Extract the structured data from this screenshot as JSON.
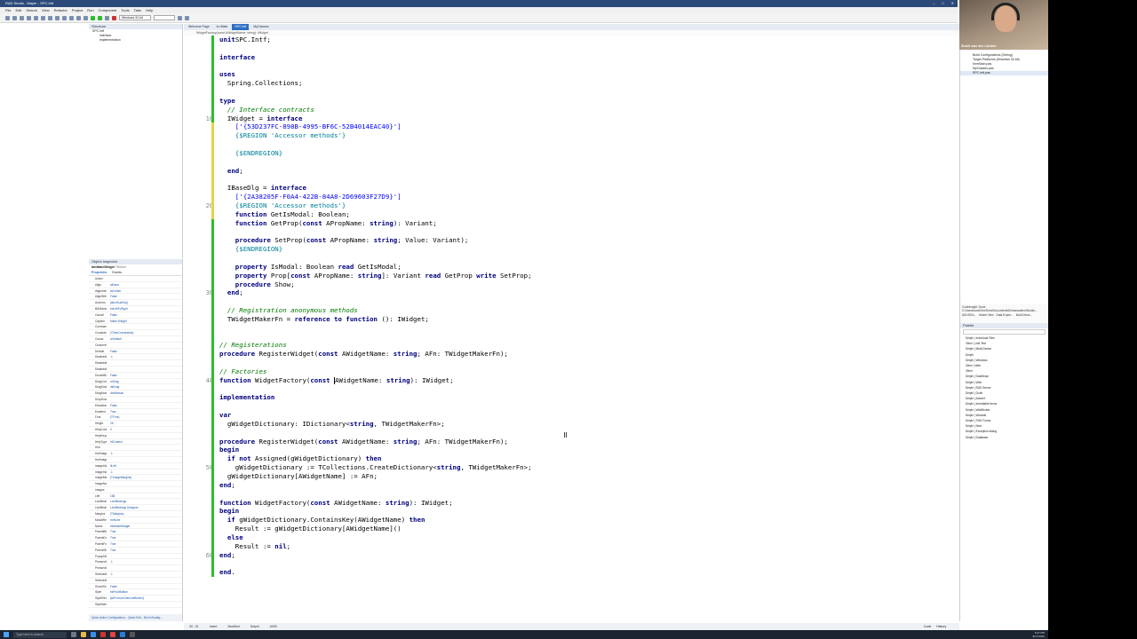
{
  "window": {
    "title": "RAD Studio - Mayer - SPC.Intf",
    "controls": [
      "–",
      "□",
      "✕"
    ]
  },
  "menu": [
    "File",
    "Edit",
    "Search",
    "View",
    "Refactor",
    "Project",
    "Run",
    "Component",
    "Tools",
    "Tabs",
    "Help"
  ],
  "toolbar": {
    "platform_combo": "Windows 32-bit"
  },
  "structure": {
    "title": "Structure",
    "items": [
      "SPC.Intf",
      "interface",
      "implementation"
    ]
  },
  "object_inspector": {
    "title": "Object Inspector",
    "component": "btnMakeWidget",
    "component_type": "TButton",
    "tabs": [
      "Properties",
      "Events"
    ],
    "rows": [
      [
        "Action",
        ""
      ],
      [
        "Align",
        "alNone"
      ],
      [
        "Alignment",
        "taCenter"
      ],
      [
        "AlignWithMargins",
        "False"
      ],
      [
        "Anchors",
        "[akLeft,akTop]"
      ],
      [
        "BiDiMode",
        "bdLeftToRight"
      ],
      [
        "Cancel",
        "False"
      ],
      [
        "Caption",
        "Make Widget"
      ],
      [
        "CommandLinkHint",
        ""
      ],
      [
        "Constraints",
        "(TSizeConstraints)"
      ],
      [
        "Cursor",
        "crDefault"
      ],
      [
        "CustomHint",
        ""
      ],
      [
        "Default",
        "False"
      ],
      [
        "DisabledImageIndex",
        "-1"
      ],
      [
        "DisabledImageName",
        ""
      ],
      [
        "DisabledImages",
        ""
      ],
      [
        "DoubleBuffered",
        "False"
      ],
      [
        "DragCursor",
        "crDrag"
      ],
      [
        "DragKind",
        "dkDrag"
      ],
      [
        "DragMode",
        "dmManual"
      ],
      [
        "DropDownMenu",
        ""
      ],
      [
        "ElevationRequired",
        "False"
      ],
      [
        "Enabled",
        "True"
      ],
      [
        "Font",
        "(TFont)"
      ],
      [
        "Height",
        "25"
      ],
      [
        "HelpContext",
        "0"
      ],
      [
        "HelpKeyword",
        ""
      ],
      [
        "HelpType",
        "htContext"
      ],
      [
        "Hint",
        ""
      ],
      [
        "HotImageIndex",
        "-1"
      ],
      [
        "HotImageName",
        ""
      ],
      [
        "ImageAlignment",
        "iiLeft"
      ],
      [
        "ImageIndex",
        "-1"
      ],
      [
        "ImageMargins",
        "(TImageMargins)"
      ],
      [
        "ImageName",
        ""
      ],
      [
        "Images",
        ""
      ],
      [
        "Left",
        "168"
      ],
      [
        "LiveBindings",
        "LiveBindings"
      ],
      [
        "LiveBindings Designer",
        "LiveBindings Designer"
      ],
      [
        "Margins",
        "(TMargins)"
      ],
      [
        "ModalResult",
        "mrNone"
      ],
      [
        "Name",
        "btnMakeWidget"
      ],
      [
        "ParentBiDiMode",
        "True"
      ],
      [
        "ParentDoubleBuffered",
        "True"
      ],
      [
        "ParentFont",
        "True"
      ],
      [
        "ParentShowHint",
        "True"
      ],
      [
        "PopupMenu",
        ""
      ],
      [
        "PressedImageIndex",
        "-1"
      ],
      [
        "PressedImageName",
        ""
      ],
      [
        "SelectedImageIndex",
        "-1"
      ],
      [
        "SelectedImageName",
        ""
      ],
      [
        "ShowHint",
        "False"
      ],
      [
        "Style",
        "bsPushButton"
      ],
      [
        "StyleElements",
        "[seFont,seClient,seBorder]"
      ],
      [
        "StyleName",
        ""
      ]
    ],
    "footer": "Quick Action Configuration...  Quick Edit...  Bind Visually...",
    "status": "All shown"
  },
  "editor": {
    "tabs": [
      "Welcome Page",
      "fo.rMain",
      "SPC.Intf",
      "MyClasses"
    ],
    "breadcrumb": [
      "WidgetFactory(const AWidgetName: string): IWidget"
    ],
    "line_numbers": [
      "10",
      "20",
      "30",
      "40",
      "50",
      "60"
    ],
    "lines": [
      [
        [
          "kw",
          "unit"
        ],
        [
          "",
          "SPC.Intf;"
        ]
      ],
      [],
      [
        [
          "kw",
          "interface"
        ]
      ],
      [],
      [
        [
          "kw",
          "uses"
        ]
      ],
      [
        [
          "",
          "  Spring.Collections;"
        ]
      ],
      [],
      [
        [
          "kw",
          "type"
        ]
      ],
      [
        [
          "cm",
          "  // Interface contracts"
        ]
      ],
      [
        [
          "",
          "  IWidget = "
        ],
        [
          "kw",
          "interface"
        ]
      ],
      [
        [
          "str",
          "    ['{53D237FC-898B-4995-BF6C-52B4014EAC40}']"
        ]
      ],
      [
        [
          "dir",
          "    {$REGION 'Accessor methods'}"
        ]
      ],
      [],
      [
        [
          "dir",
          "    {$ENDREGION}"
        ]
      ],
      [],
      [
        [
          "kw",
          "  end"
        ],
        [
          "",
          ";"
        ]
      ],
      [],
      [
        [
          "",
          "  IBaseDlg = "
        ],
        [
          "kw",
          "interface"
        ]
      ],
      [
        [
          "str",
          "    ['{2A38205F-F0A4-422B-84A8-2D69603F27D9}']"
        ]
      ],
      [
        [
          "dir",
          "    {$REGION 'Accessor methods'}"
        ]
      ],
      [
        [
          "kw",
          "    function"
        ],
        [
          "",
          " GetIsModal: Boolean;"
        ]
      ],
      [
        [
          "kw",
          "    function"
        ],
        [
          "",
          " GetProp("
        ],
        [
          "kw",
          "const"
        ],
        [
          "",
          " APropName: "
        ],
        [
          "kw",
          "string"
        ],
        [
          "",
          "): Variant;"
        ]
      ],
      [],
      [
        [
          "kw",
          "    procedure"
        ],
        [
          "",
          " SetProp("
        ],
        [
          "kw",
          "const"
        ],
        [
          "",
          " APropName: "
        ],
        [
          "kw",
          "string"
        ],
        [
          "",
          "; Value: Variant);"
        ]
      ],
      [
        [
          "dir",
          "    {$ENDREGION}"
        ]
      ],
      [],
      [
        [
          "kw",
          "    property"
        ],
        [
          "",
          " IsModal: Boolean "
        ],
        [
          "kw",
          "read"
        ],
        [
          "",
          " GetIsModal;"
        ]
      ],
      [
        [
          "kw",
          "    property"
        ],
        [
          "",
          " Prop["
        ],
        [
          "kw",
          "const"
        ],
        [
          "",
          " APropName: "
        ],
        [
          "kw",
          "string"
        ],
        [
          "",
          "]: Variant "
        ],
        [
          "kw",
          "read"
        ],
        [
          "",
          " GetProp "
        ],
        [
          "kw",
          "write"
        ],
        [
          "",
          " SetProp;"
        ]
      ],
      [
        [
          "kw",
          "    procedure"
        ],
        [
          "",
          " Show;"
        ]
      ],
      [
        [
          "kw",
          "  end"
        ],
        [
          "",
          ";"
        ]
      ],
      [],
      [
        [
          "cm",
          "  // Registration anonymous methods"
        ]
      ],
      [
        [
          "",
          "  TWidgetMakerFn = "
        ],
        [
          "kw",
          "reference to function"
        ],
        [
          "",
          " (): IWidget;"
        ]
      ],
      [],
      [],
      [
        [
          "cm",
          "// Registerations"
        ]
      ],
      [
        [
          "kw",
          "procedure"
        ],
        [
          "",
          " RegisterWidget("
        ],
        [
          "kw",
          "const"
        ],
        [
          "",
          " AWidgetName: "
        ],
        [
          "kw",
          "string"
        ],
        [
          "",
          "; AFn: TWidgetMakerFn);"
        ]
      ],
      [],
      [
        [
          "cm",
          "// Factories"
        ]
      ],
      [
        [
          "kw",
          "function"
        ],
        [
          "",
          " WidgetFactory("
        ],
        [
          "kw",
          "const"
        ],
        [
          "",
          " "
        ],
        [
          "caret",
          ""
        ],
        [
          "",
          "AWidgetName: "
        ],
        [
          "kw",
          "string"
        ],
        [
          "",
          "): IWidget;"
        ]
      ],
      [],
      [
        [
          "kw",
          "implementation"
        ]
      ],
      [],
      [
        [
          "kw",
          "var"
        ]
      ],
      [
        [
          "",
          "  gWidgetDictionary: IDictionary<"
        ],
        [
          "kw",
          "string"
        ],
        [
          "",
          ", TWidgetMakerFn>;"
        ]
      ],
      [],
      [
        [
          "kw",
          "procedure"
        ],
        [
          "",
          " RegisterWidget("
        ],
        [
          "kw",
          "const"
        ],
        [
          "",
          " AWidgetName: "
        ],
        [
          "kw",
          "string"
        ],
        [
          "",
          "; AFn: TWidgetMakerFn);"
        ]
      ],
      [
        [
          "kw",
          "begin"
        ]
      ],
      [
        [
          "kw",
          "  if not"
        ],
        [
          "",
          " Assigned(gWidgetDictionary) "
        ],
        [
          "kw",
          "then"
        ]
      ],
      [
        [
          "",
          "    gWidgetDictionary := TCollections.CreateDictionary<"
        ],
        [
          "kw",
          "string"
        ],
        [
          "",
          ", TWidgetMakerFn>;"
        ]
      ],
      [
        [
          "",
          "  gWidgetDictionary[AWidgetName] := AFn;"
        ]
      ],
      [
        [
          "kw",
          "end"
        ],
        [
          "",
          ";"
        ]
      ],
      [],
      [
        [
          "kw",
          "function"
        ],
        [
          "",
          " WidgetFactory("
        ],
        [
          "kw",
          "const"
        ],
        [
          "",
          " AWidgetName: "
        ],
        [
          "kw",
          "string"
        ],
        [
          "",
          "): IWidget;"
        ]
      ],
      [
        [
          "kw",
          "begin"
        ]
      ],
      [
        [
          "kw",
          "  if"
        ],
        [
          "",
          " gWidgetDictionary.ContainsKey(AWidgetName) "
        ],
        [
          "kw",
          "then"
        ]
      ],
      [
        [
          "",
          "    Result := gWidgetDictionary[AWidgetName]()"
        ]
      ],
      [
        [
          "kw",
          "  else"
        ]
      ],
      [
        [
          "",
          "    Result := "
        ],
        [
          "kw",
          "nil"
        ],
        [
          "",
          ";"
        ]
      ],
      [
        [
          "kw",
          "end"
        ],
        [
          "",
          ";"
        ]
      ],
      [],
      [
        [
          "kw",
          "end"
        ],
        [
          "",
          "."
        ]
      ]
    ],
    "status": [
      "40 : 31",
      "Insert",
      "Modified",
      "Delphi",
      "ANSI"
    ],
    "view_tabs": [
      "Code",
      "History"
    ]
  },
  "webcam": {
    "name": "Scott van der Linden"
  },
  "project_manager": {
    "items": [
      "Build Configurations (Debug)",
      "Target Platforms (Windows 32-bit)",
      "formMain.pas",
      "MyClasses.pas",
      "SPC.Intf.pas"
    ]
  },
  "code_insight": {
    "line1": "CodeInsight: Done",
    "line2": "C:\\Users\\scott\\OneDrive\\Documents\\Embarcadero\\Studio\\...",
    "tabs": [
      "ADUGEA...",
      "Model View",
      "Data Explor...",
      "Multi-Devic..."
    ]
  },
  "palette": {
    "title": "Palette",
    "items": [
      "Delphi | Individual Files",
      "Other | Unit Test",
      "Delphi | Multi-Device",
      "Delphi",
      "Delphi | Windows",
      "Other | Web",
      "Other",
      "Delphi | DataSnap",
      "Delphi | Web",
      "Delphi | RAD Server",
      "Delphi | Dunit",
      "Delphi | ActiveX",
      "Delphi | Inheritable Items",
      "Delphi | WebBroker",
      "Delphi | Wizards",
      "Delphi | TMS Forms",
      "Delphi | New",
      "Delphi | Exception dialog",
      "Delphi | Database"
    ]
  },
  "taskbar": {
    "search": "Type here to search",
    "time": "5:27 PM",
    "date": "8/17/2020"
  }
}
